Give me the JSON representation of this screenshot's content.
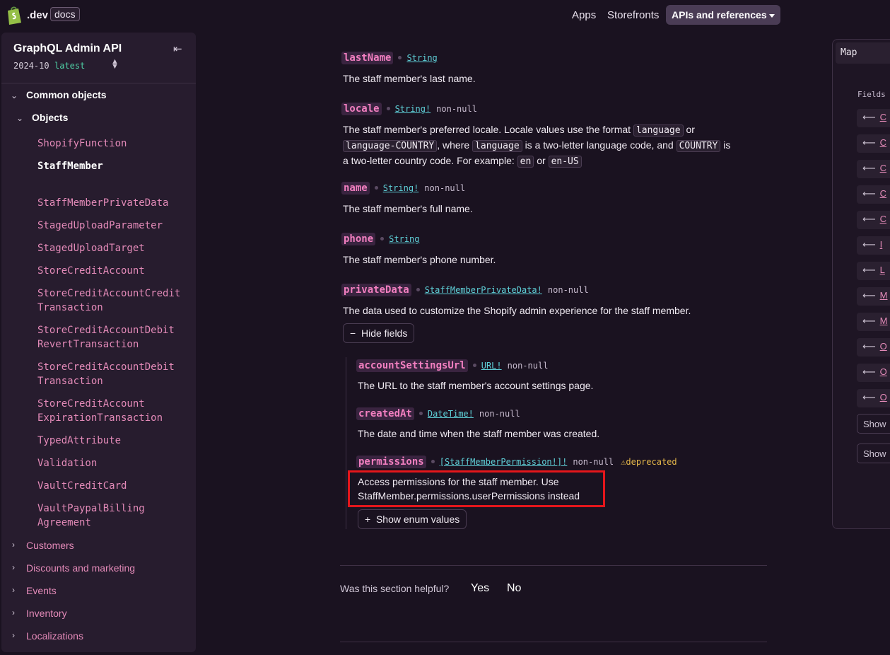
{
  "header": {
    "logo_dev": ".dev",
    "logo_docs": "docs",
    "nav": [
      "Apps",
      "Storefronts"
    ],
    "nav_active": "APIs and references"
  },
  "sidebar": {
    "title": "GraphQL Admin API",
    "version": "2024-10",
    "version_tag": "latest",
    "group": "Common objects",
    "subgroup": "Objects",
    "items": [
      "ShopifyFunction",
      "StaffMember",
      "StaffMemberPrivateData",
      "StagedUploadParameter",
      "StagedUploadTarget",
      "StoreCreditAccount",
      "StoreCreditAccountCredit\nTransaction",
      "StoreCreditAccountDebit\nRevertTransaction",
      "StoreCreditAccountDebit\nTransaction",
      "StoreCreditAccount\nExpirationTransaction",
      "TypedAttribute",
      "Validation",
      "VaultCreditCard",
      "VaultPaypalBilling\nAgreement"
    ],
    "sections": [
      "Customers",
      "Discounts and marketing",
      "Events",
      "Inventory",
      "Localizations"
    ]
  },
  "fields": {
    "lastName": {
      "name": "lastName",
      "type": "String",
      "desc": "The staff member's last name."
    },
    "locale": {
      "name": "locale",
      "type": "String!",
      "nn": "non-null",
      "desc_a": "The staff member's preferred locale. Locale values use the format",
      "code_language": "language",
      "or1": "or",
      "code_language_country": "language-COUNTRY",
      "desc_b": ", where",
      "desc_c": "is a two-letter language code, and",
      "code_country": "COUNTRY",
      "desc_d": "is",
      "desc_e": "a two-letter country code. For example:",
      "code_en": "en",
      "or2": "or",
      "code_en_us": "en-US"
    },
    "name": {
      "name": "name",
      "type": "String!",
      "nn": "non-null",
      "desc": "The staff member's full name."
    },
    "phone": {
      "name": "phone",
      "type": "String",
      "desc": "The staff member's phone number."
    },
    "privateData": {
      "name": "privateData",
      "type": "StaffMemberPrivateData!",
      "nn": "non-null",
      "desc": "The data used to customize the Shopify admin experience for the staff member.",
      "button": "Hide fields"
    },
    "accountSettingsUrl": {
      "name": "accountSettingsUrl",
      "type": "URL!",
      "nn": "non-null",
      "desc": "The URL to the staff member's account settings page."
    },
    "createdAt": {
      "name": "createdAt",
      "type": "DateTime!",
      "nn": "non-null",
      "desc": "The date and time when the staff member was created."
    },
    "permissions": {
      "name": "permissions",
      "type": "[StaffMemberPermission!]!",
      "nn": "non-null",
      "deprecated": "deprecated",
      "desc_1": "Access permissions for the staff member. Use",
      "desc_2": "StaffMember.permissions.userPermissions instead",
      "button": "Show enum values"
    }
  },
  "feedback": {
    "question": "Was this section helpful?",
    "yes": "Yes",
    "no": "No"
  },
  "map": {
    "title": "Map",
    "fields_label": "Fields",
    "show_label": "Show",
    "rows": [
      "C",
      "C",
      "C",
      "C",
      "C",
      "I",
      "L",
      "M",
      "M",
      "O",
      "O",
      "O"
    ]
  },
  "colors": {
    "background": "#1a1220",
    "accent_pink": "#f27fc0",
    "type_cyan": "#5fd0d8",
    "highlight": "#e4161b"
  }
}
